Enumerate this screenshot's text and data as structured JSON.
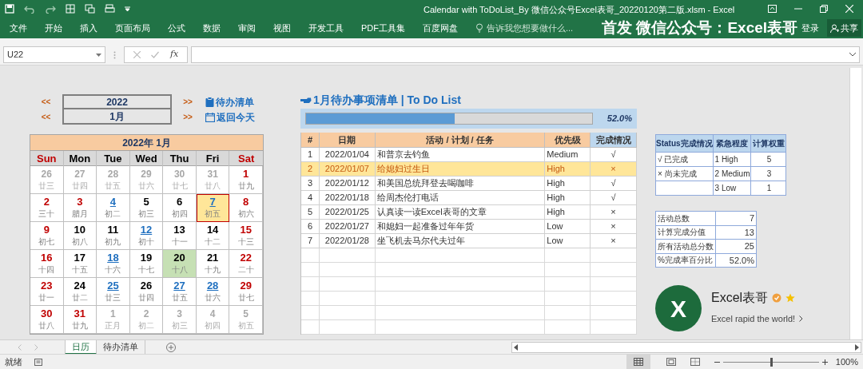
{
  "window": {
    "title": "Calendar with ToDoList_By 微信公众号Excel表哥_20220120第二版.xlsm - Excel",
    "brand": "首发 微信公众号：Excel表哥",
    "sign_in": "登录",
    "share": "共享"
  },
  "ribbon_tabs": [
    "文件",
    "开始",
    "插入",
    "页面布局",
    "公式",
    "数据",
    "审阅",
    "视图",
    "开发工具",
    "PDF工具集",
    "百度网盘"
  ],
  "tell_me": {
    "placeholder": "告诉我您想要做什么..."
  },
  "formula_bar": {
    "name_box": "U22",
    "function_label": "fx"
  },
  "calendar": {
    "prev": "<<",
    "next": ">>",
    "year": "2022",
    "month": "1月",
    "links": [
      {
        "label": "待办清单",
        "kind": "clipboard"
      },
      {
        "label": "返回今天",
        "kind": "calendar"
      }
    ],
    "title": "2022年 1月",
    "weekdays": [
      {
        "label": "Sun",
        "color": "#c00000"
      },
      {
        "label": "Mon",
        "color": "#000000"
      },
      {
        "label": "Tue",
        "color": "#000000"
      },
      {
        "label": "Wed",
        "color": "#000000"
      },
      {
        "label": "Thu",
        "color": "#000000"
      },
      {
        "label": "Fri",
        "color": "#000000"
      },
      {
        "label": "Sat",
        "color": "#c00000"
      }
    ],
    "weeks": [
      [
        {
          "day": "26",
          "lunar": "廿三",
          "kind": "other"
        },
        {
          "day": "27",
          "lunar": "廿四",
          "kind": "other"
        },
        {
          "day": "28",
          "lunar": "廿五",
          "kind": "other"
        },
        {
          "day": "29",
          "lunar": "廿六",
          "kind": "other"
        },
        {
          "day": "30",
          "lunar": "廿七",
          "kind": "other"
        },
        {
          "day": "31",
          "lunar": "廿八",
          "kind": "other"
        },
        {
          "day": "1",
          "lunar": "廿九",
          "kind": "day",
          "color": "#c00000",
          "linked": false,
          "selected": false,
          "today": false
        }
      ],
      [
        {
          "day": "2",
          "lunar": "三十",
          "kind": "day",
          "color": "#c00000",
          "linked": false,
          "selected": false,
          "today": false
        },
        {
          "day": "3",
          "lunar": "腊月",
          "kind": "day",
          "color": "#c00000",
          "linked": false,
          "selected": false,
          "today": false
        },
        {
          "day": "4",
          "lunar": "初二",
          "kind": "day",
          "color": "#1f6fbf",
          "linked": true,
          "selected": false,
          "today": false
        },
        {
          "day": "5",
          "lunar": "初三",
          "kind": "day",
          "color": "#000000",
          "linked": false,
          "selected": false,
          "today": false
        },
        {
          "day": "6",
          "lunar": "初四",
          "kind": "day",
          "color": "#000000",
          "linked": false,
          "selected": false,
          "today": false
        },
        {
          "day": "7",
          "lunar": "初五",
          "kind": "day",
          "color": "#1f6fbf",
          "linked": true,
          "selected": true,
          "today": false
        },
        {
          "day": "8",
          "lunar": "初六",
          "kind": "day",
          "color": "#c00000",
          "linked": false,
          "selected": false,
          "today": false
        }
      ],
      [
        {
          "day": "9",
          "lunar": "初七",
          "kind": "day",
          "color": "#c00000",
          "linked": false,
          "selected": false,
          "today": false
        },
        {
          "day": "10",
          "lunar": "初八",
          "kind": "day",
          "color": "#000000",
          "linked": false,
          "selected": false,
          "today": false
        },
        {
          "day": "11",
          "lunar": "初九",
          "kind": "day",
          "color": "#000000",
          "linked": false,
          "selected": false,
          "today": false
        },
        {
          "day": "12",
          "lunar": "初十",
          "kind": "day",
          "color": "#1f6fbf",
          "linked": true,
          "selected": false,
          "today": false
        },
        {
          "day": "13",
          "lunar": "十一",
          "kind": "day",
          "color": "#000000",
          "linked": false,
          "selected": false,
          "today": false
        },
        {
          "day": "14",
          "lunar": "十二",
          "kind": "day",
          "color": "#000000",
          "linked": false,
          "selected": false,
          "today": false
        },
        {
          "day": "15",
          "lunar": "十三",
          "kind": "day",
          "color": "#c00000",
          "linked": false,
          "selected": false,
          "today": false
        }
      ],
      [
        {
          "day": "16",
          "lunar": "十四",
          "kind": "day",
          "color": "#c00000",
          "linked": false,
          "selected": false,
          "today": false
        },
        {
          "day": "17",
          "lunar": "十五",
          "kind": "day",
          "color": "#000000",
          "linked": false,
          "selected": false,
          "today": false
        },
        {
          "day": "18",
          "lunar": "十六",
          "kind": "day",
          "color": "#1f6fbf",
          "linked": true,
          "selected": false,
          "today": false
        },
        {
          "day": "19",
          "lunar": "十七",
          "kind": "day",
          "color": "#000000",
          "linked": false,
          "selected": false,
          "today": false
        },
        {
          "day": "20",
          "lunar": "十八",
          "kind": "day",
          "color": "#000000",
          "linked": false,
          "selected": false,
          "today": true
        },
        {
          "day": "21",
          "lunar": "十九",
          "kind": "day",
          "color": "#000000",
          "linked": false,
          "selected": false,
          "today": false
        },
        {
          "day": "22",
          "lunar": "二十",
          "kind": "day",
          "color": "#c00000",
          "linked": false,
          "selected": false,
          "today": false
        }
      ],
      [
        {
          "day": "23",
          "lunar": "廿一",
          "kind": "day",
          "color": "#c00000",
          "linked": false,
          "selected": false,
          "today": false
        },
        {
          "day": "24",
          "lunar": "廿二",
          "kind": "day",
          "color": "#000000",
          "linked": false,
          "selected": false,
          "today": false
        },
        {
          "day": "25",
          "lunar": "廿三",
          "kind": "day",
          "color": "#1f6fbf",
          "linked": true,
          "selected": false,
          "today": false
        },
        {
          "day": "26",
          "lunar": "廿四",
          "kind": "day",
          "color": "#000000",
          "linked": false,
          "selected": false,
          "today": false
        },
        {
          "day": "27",
          "lunar": "廿五",
          "kind": "day",
          "color": "#1f6fbf",
          "linked": true,
          "selected": false,
          "today": false
        },
        {
          "day": "28",
          "lunar": "廿六",
          "kind": "day",
          "color": "#1f6fbf",
          "linked": true,
          "selected": false,
          "today": false
        },
        {
          "day": "29",
          "lunar": "廿七",
          "kind": "day",
          "color": "#c00000",
          "linked": false,
          "selected": false,
          "today": false
        }
      ],
      [
        {
          "day": "30",
          "lunar": "廿八",
          "kind": "day",
          "color": "#c00000",
          "linked": false,
          "selected": false,
          "today": false
        },
        {
          "day": "31",
          "lunar": "廿九",
          "kind": "day",
          "color": "#c00000",
          "linked": false,
          "selected": false,
          "today": false
        },
        {
          "day": "1",
          "lunar": "正月",
          "kind": "other"
        },
        {
          "day": "2",
          "lunar": "初二",
          "kind": "other"
        },
        {
          "day": "3",
          "lunar": "初三",
          "kind": "other"
        },
        {
          "day": "4",
          "lunar": "初四",
          "kind": "other"
        },
        {
          "day": "5",
          "lunar": "初五",
          "kind": "other"
        }
      ]
    ]
  },
  "todo": {
    "title": "1月待办事项清单 | To Do List",
    "level": 0.52,
    "reading": "52.0%",
    "columns": [
      "#",
      "日期",
      "活动 / 计划 / 任务",
      "优先级",
      "完成情况"
    ],
    "rows": [
      {
        "cells": [
          "1",
          "2022/01/04",
          "和普京去钓鱼",
          "Medium",
          "√"
        ],
        "selected": false
      },
      {
        "cells": [
          "2",
          "2022/01/07",
          "给媳妇过生日",
          "High",
          "×"
        ],
        "selected": true
      },
      {
        "cells": [
          "3",
          "2022/01/12",
          "和美国总统拜登去喝咖啡",
          "High",
          "√"
        ],
        "selected": false
      },
      {
        "cells": [
          "4",
          "2022/01/18",
          "给周杰伦打电话",
          "High",
          "√"
        ],
        "selected": false
      },
      {
        "cells": [
          "5",
          "2022/01/25",
          "认真读一读Excel表哥的文章",
          "High",
          "×"
        ],
        "selected": false
      },
      {
        "cells": [
          "6",
          "2022/01/27",
          "和媳妇一起准备过年年货",
          "Low",
          "×"
        ],
        "selected": false
      },
      {
        "cells": [
          "7",
          "2022/01/28",
          "坐飞机去马尔代夫过年",
          "Low",
          "×"
        ],
        "selected": false
      }
    ]
  },
  "legend": {
    "columns": [
      "Status完成情况",
      "紧急程度",
      "计算权重"
    ],
    "rows": [
      {
        "status": "√ 已完成",
        "urgency": "1 High",
        "weight": "5"
      },
      {
        "status": "× 尚未完成",
        "urgency": "2 Medium",
        "weight": "3"
      },
      {
        "urgency": "3 Low",
        "weight": "1"
      }
    ]
  },
  "stats": [
    {
      "label": "活动总数",
      "value": "7"
    },
    {
      "label": "计算完成分值",
      "value": "13"
    },
    {
      "label": "所有活动总分数",
      "value": "25"
    },
    {
      "label": "%完成率百分比",
      "value": "52.0%"
    }
  ],
  "profile": {
    "logo_letter": "X",
    "name": "Excel表哥",
    "tagline": "Excel rapid the world!"
  },
  "sheet_tabs": [
    {
      "label": "日历",
      "selected": true
    },
    {
      "label": "待办清单",
      "selected": false
    }
  ],
  "status_bar": {
    "text": "就绪",
    "zoom": "100%",
    "zoom_slider": {
      "level": 0.5
    }
  }
}
